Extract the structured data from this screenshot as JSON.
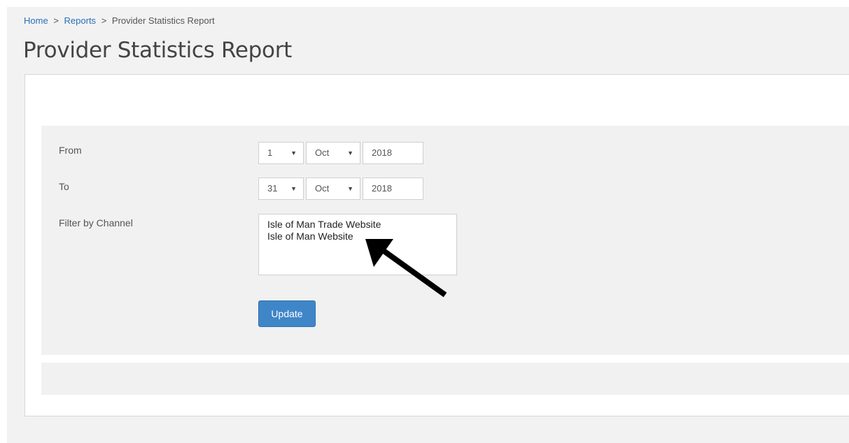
{
  "breadcrumb": {
    "home": "Home",
    "sep1": ">",
    "reports": "Reports",
    "sep2": ">",
    "current": "Provider Statistics Report"
  },
  "page_title": "Provider Statistics Report",
  "form": {
    "from_label": "From",
    "to_label": "To",
    "channel_label": "Filter by Channel",
    "from": {
      "day": "1",
      "month": "Oct",
      "year": "2018"
    },
    "to": {
      "day": "31",
      "month": "Oct",
      "year": "2018"
    },
    "channels": [
      "Isle of Man Trade Website",
      "Isle of Man Website"
    ],
    "update_label": "Update"
  },
  "icons": {
    "dropdown": "triangle-down-icon",
    "annotation": "arrow-pointer-icon"
  },
  "colors": {
    "primary_button": "#3f86c9",
    "link": "#2a6ebb",
    "page_bg": "#f2f2f2"
  }
}
